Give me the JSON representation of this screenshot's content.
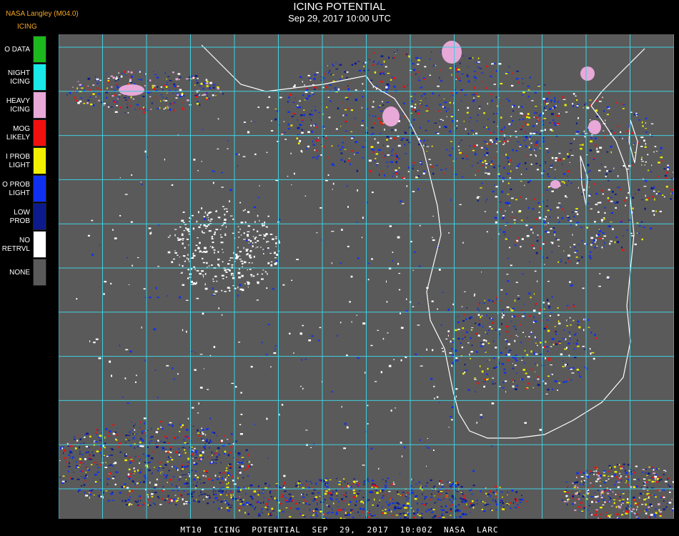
{
  "header": {
    "brand": "NASA Langley (M04.0)",
    "title": "ICING POTENTIAL",
    "datetime": "Sep 29, 2017 10:00 UTC",
    "legend_title": "ICING"
  },
  "legend": {
    "items": [
      {
        "label": "O DATA",
        "color": "#1db81d"
      },
      {
        "label": "NIGHT\nICING",
        "color": "#19e8e8"
      },
      {
        "label": "HEAVY\nICING",
        "color": "#e8a8d8"
      },
      {
        "label": "MOG\nLIKELY",
        "color": "#f01010"
      },
      {
        "label": "I PROB\nLIGHT",
        "color": "#f0f000"
      },
      {
        "label": "O PROB\nLIGHT",
        "color": "#1030f0"
      },
      {
        "label": "LOW\nPROB",
        "color": "#0c1a8c"
      },
      {
        "label": "NO\nRETRVL",
        "color": "#ffffff"
      },
      {
        "label": "NONE",
        "color": "#5a5a5a"
      }
    ]
  },
  "map": {
    "background_color": "#5a5a5a",
    "gridline_color": "#3fd0e0",
    "coastline_color": "#ffffff",
    "grid_label_color": "#c04040"
  },
  "footer": {
    "text": "MT10  ICING POTENTIAL   SEP 29, 2017 10:00Z   NASA LARC"
  }
}
